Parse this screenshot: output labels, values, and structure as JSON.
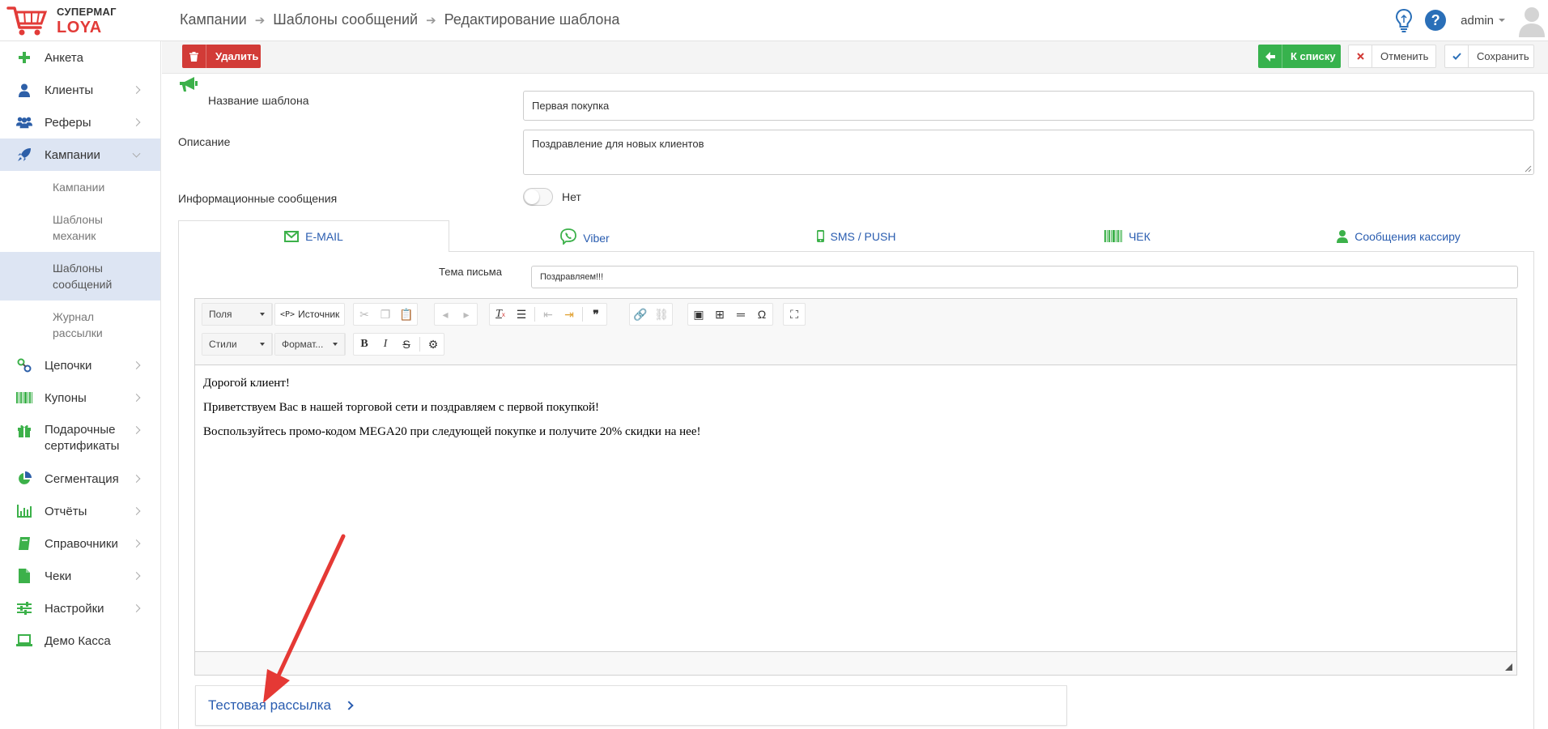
{
  "header": {
    "logo_line1": "СУПЕРМАГ",
    "logo_line2": "LOYA",
    "breadcrumb": [
      "Кампании",
      "Шаблоны сообщений",
      "Редактирование шаблона"
    ],
    "user": "admin"
  },
  "sidebar": {
    "items": [
      {
        "label": "Анкета",
        "icon": "plus-icon"
      },
      {
        "label": "Клиенты",
        "icon": "user-icon"
      },
      {
        "label": "Реферы",
        "icon": "users-icon"
      },
      {
        "label": "Кампании",
        "icon": "rocket-icon"
      },
      {
        "label": "Цепочки",
        "icon": "chain-icon"
      },
      {
        "label": "Купоны",
        "icon": "barcode-icon"
      },
      {
        "label": "Подарочные сертификаты",
        "icon": "gift-icon"
      },
      {
        "label": "Сегментация",
        "icon": "pie-chart-icon"
      },
      {
        "label": "Отчёты",
        "icon": "bar-chart-icon"
      },
      {
        "label": "Справочники",
        "icon": "book-icon"
      },
      {
        "label": "Чеки",
        "icon": "receipt-icon"
      },
      {
        "label": "Настройки",
        "icon": "sliders-icon"
      },
      {
        "label": "Демо Касса",
        "icon": "laptop-icon"
      }
    ],
    "campaign_subitems": [
      "Кампании",
      "Шаблоны механик",
      "Шаблоны сообщений",
      "Журнал рассылки"
    ]
  },
  "toolbar": {
    "delete_label": "Удалить",
    "back_label": "К списку",
    "cancel_label": "Отменить",
    "save_label": "Сохранить"
  },
  "form": {
    "name_label": "Название шаблона",
    "name_value": "Первая покупка",
    "desc_label": "Описание",
    "desc_value": "Поздравление для новых клиентов",
    "info_label": "Информационные сообщения",
    "info_toggle_text": "Нет"
  },
  "tabs": [
    {
      "label": "E-MAIL",
      "icon": "envelope-icon"
    },
    {
      "label": "Viber",
      "icon": "viber-icon"
    },
    {
      "label": "SMS / PUSH",
      "icon": "mobile-icon"
    },
    {
      "label": "ЧЕК",
      "icon": "barcode-icon"
    },
    {
      "label": "Сообщения кассиру",
      "icon": "user-icon"
    }
  ],
  "email": {
    "subject_label": "Тема письма",
    "subject_value": "Поздравляем!!!",
    "toolbar": {
      "fields_combo": "Поля",
      "source_label": "Источник",
      "styles_combo": "Стили",
      "format_combo": "Формат..."
    },
    "body": [
      "Дорогой клиент!",
      "Приветствуем Вас в нашей торговой сети и поздравляем с первой покупкой!",
      "Воспользуйтесь промо-кодом MEGA20 при следующей покупке и получите 20% скидки на нее!"
    ]
  },
  "test_mailing": {
    "label": "Тестовая рассылка"
  },
  "colors": {
    "brand_red": "#e23b38",
    "delete_red": "#d23b37",
    "success_green": "#37b24d",
    "link_blue": "#2a5db0",
    "active_bg": "#dde5f3"
  }
}
